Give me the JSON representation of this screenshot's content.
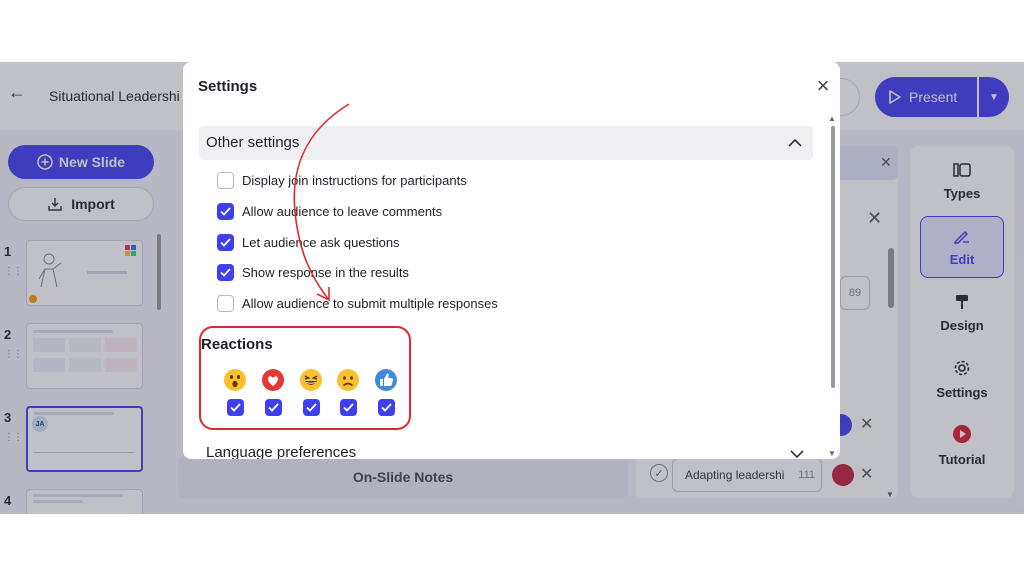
{
  "app": {
    "deck_title": "Situational Leadershi",
    "present_label": "Present"
  },
  "left_panel": {
    "new_slide_label": "New Slide",
    "import_label": "Import",
    "slides": [
      {
        "number": "1"
      },
      {
        "number": "2"
      },
      {
        "number": "3",
        "badge": "JA"
      },
      {
        "number": "4"
      }
    ]
  },
  "center": {
    "notes_label": "On-Slide Notes"
  },
  "edit_panel": {
    "char_count": "89",
    "option": {
      "text": "Adapting leadershi",
      "count": "111"
    }
  },
  "right_nav": {
    "items": [
      {
        "label": "Types",
        "icon": "columns-icon"
      },
      {
        "label": "Edit",
        "icon": "edit-pen-icon"
      },
      {
        "label": "Design",
        "icon": "paint-roller-icon"
      },
      {
        "label": "Settings",
        "icon": "gear-icon"
      },
      {
        "label": "Tutorial",
        "icon": "play-circle-icon"
      }
    ]
  },
  "modal": {
    "title": "Settings",
    "other_settings": {
      "title": "Other settings",
      "options": [
        {
          "label": "Display join instructions for participants",
          "checked": false
        },
        {
          "label": "Allow audience to leave comments",
          "checked": true
        },
        {
          "label": "Let audience ask questions",
          "checked": true
        },
        {
          "label": "Show response in the results",
          "checked": true
        },
        {
          "label": "Allow audience to submit multiple responses",
          "checked": false
        }
      ]
    },
    "reactions": {
      "title": "Reactions",
      "items": [
        {
          "emoji": "wow",
          "checked": true
        },
        {
          "emoji": "heart",
          "checked": true
        },
        {
          "emoji": "laugh",
          "checked": true
        },
        {
          "emoji": "sad",
          "checked": true
        },
        {
          "emoji": "thumbs-up",
          "checked": true
        }
      ]
    },
    "language_preferences": "Language preferences"
  },
  "colors": {
    "accent": "#3f3ff0",
    "annotation_red": "#e0282f"
  }
}
